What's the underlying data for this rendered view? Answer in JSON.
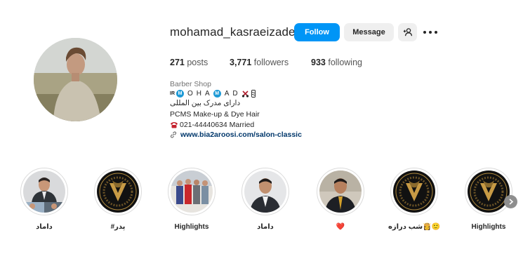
{
  "profile": {
    "username": "mohamad_kasraeizade",
    "avatar_icon": "profile-photo-man-in-field",
    "buttons": {
      "follow": "Follow",
      "message": "Message",
      "suggest_icon": "add-person-icon",
      "more_icon": "more-options-icon"
    },
    "stats": {
      "posts_count": "271",
      "posts_label": "posts",
      "followers_count": "3,771",
      "followers_label": "followers",
      "following_count": "933",
      "following_label": "following"
    },
    "bio": {
      "category": "Barber Shop",
      "line1_prefix": "IR",
      "line1_letters": [
        "M",
        "O",
        "H",
        "A",
        "M",
        "A",
        "D"
      ],
      "line2": "دارای مدرک بین المللی",
      "line3": "PCMS Make-up & Dye Hair",
      "line4": "021-44440634 Married",
      "link": "www.bia2aroosi.com/salon-classic",
      "link_icon": "link-icon"
    }
  },
  "highlights": [
    {
      "label": "داماد",
      "cover": "photo-groom-collage"
    },
    {
      "label": "#پدر",
      "cover": "logo-gold-black"
    },
    {
      "label": "Highlights",
      "cover": "photo-group"
    },
    {
      "label": "داماد",
      "cover": "photo-man-suit"
    },
    {
      "label": "❤️",
      "cover": "photo-man-tie"
    },
    {
      "label": "شب درازه👸🙂",
      "cover": "logo-gold-black"
    },
    {
      "label": "Highlights",
      "cover": "logo-gold-black"
    }
  ],
  "colors": {
    "primary": "#0095f6",
    "link": "#00376b",
    "text": "#262626",
    "muted": "#737373",
    "ring": "#dbdbdb",
    "secondary_bg": "#efefef"
  }
}
